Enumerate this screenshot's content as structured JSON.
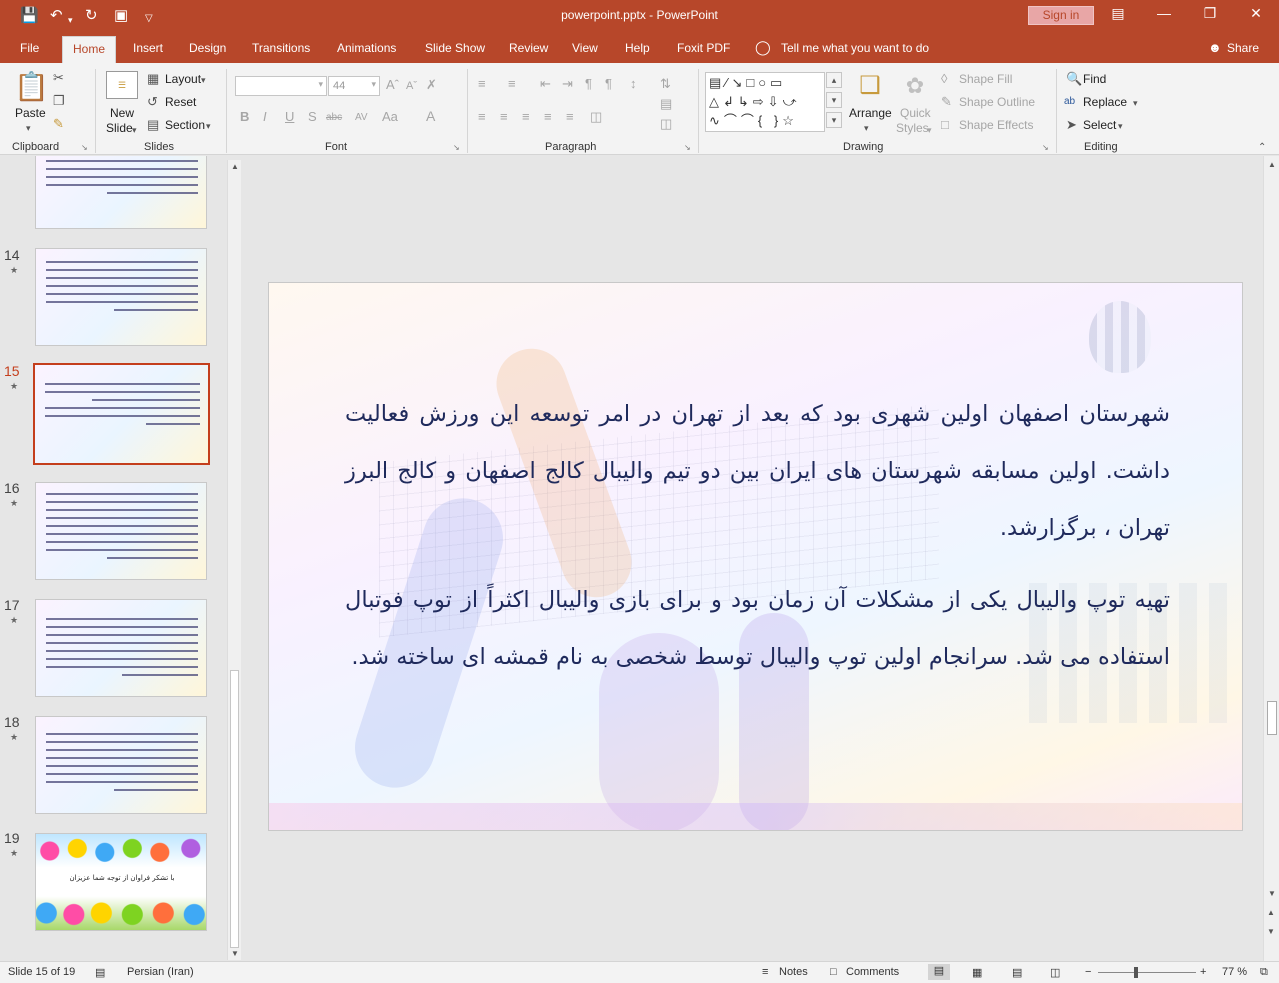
{
  "window": {
    "title": "powerpoint.pptx - PowerPoint",
    "signin_label": "Sign in"
  },
  "quick_access": [
    "save-icon",
    "undo-icon",
    "redo-icon",
    "slideshow-start-icon",
    "customize-icon"
  ],
  "tabs": [
    "File",
    "Home",
    "Insert",
    "Design",
    "Transitions",
    "Animations",
    "Slide Show",
    "Review",
    "View",
    "Help",
    "Foxit PDF"
  ],
  "active_tab": "Home",
  "tell_me": "Tell me what you want to do",
  "share_label": "Share",
  "ribbon": {
    "clipboard": {
      "label": "Clipboard",
      "paste": "Paste"
    },
    "slides": {
      "label": "Slides",
      "new_slide_1": "New",
      "new_slide_2": "Slide",
      "layout": "Layout",
      "reset": "Reset",
      "section": "Section"
    },
    "font": {
      "label": "Font",
      "size": "44",
      "bold": "B",
      "italic": "I",
      "underline": "U",
      "shadow": "S",
      "strike": "abc",
      "spacing": "AV",
      "case": "Aa",
      "color": "A"
    },
    "paragraph": {
      "label": "Paragraph"
    },
    "drawing": {
      "label": "Drawing",
      "arrange": "Arrange",
      "quick_styles_1": "Quick",
      "quick_styles_2": "Styles",
      "shape_fill": "Shape Fill",
      "shape_outline": "Shape Outline",
      "shape_effects": "Shape Effects"
    },
    "editing": {
      "label": "Editing",
      "find": "Find",
      "replace": "Replace",
      "select": "Select"
    }
  },
  "slides_panel": [
    {
      "num": "14",
      "selected": false
    },
    {
      "num": "15",
      "selected": true
    },
    {
      "num": "16",
      "selected": false
    },
    {
      "num": "17",
      "selected": false
    },
    {
      "num": "18",
      "selected": false
    },
    {
      "num": "19",
      "selected": false
    }
  ],
  "thumb19_text": "با تشکر فراوان از توجه شما عزیزان",
  "slide": {
    "para1": "شهرستان اصفهان اولین شهری بود که بعد از تهران در امر توسعه این ورزش فعالیت داشت. اولین مسابقه شهرستان های ایران بین دو تیم والیبال کالج اصفهان و کالج البرز تهران ، برگزارشد.",
    "para2": "تهیه توپ والیبال یکی از مشکلات آن زمان بود و برای بازی والیبال اکثراً از توپ فوتبال استفاده می شد. سرانجام اولین توپ والیبال توسط شخصی به نام قمشه ای ساخته شد."
  },
  "status": {
    "slide_of": "Slide 15 of 19",
    "language": "Persian (Iran)",
    "notes": "Notes",
    "comments": "Comments",
    "zoom": "77 %"
  },
  "colors": {
    "accent": "#b7472a",
    "slide_text": "#1f2a5c",
    "selected_thumb": "#c43e1c"
  }
}
